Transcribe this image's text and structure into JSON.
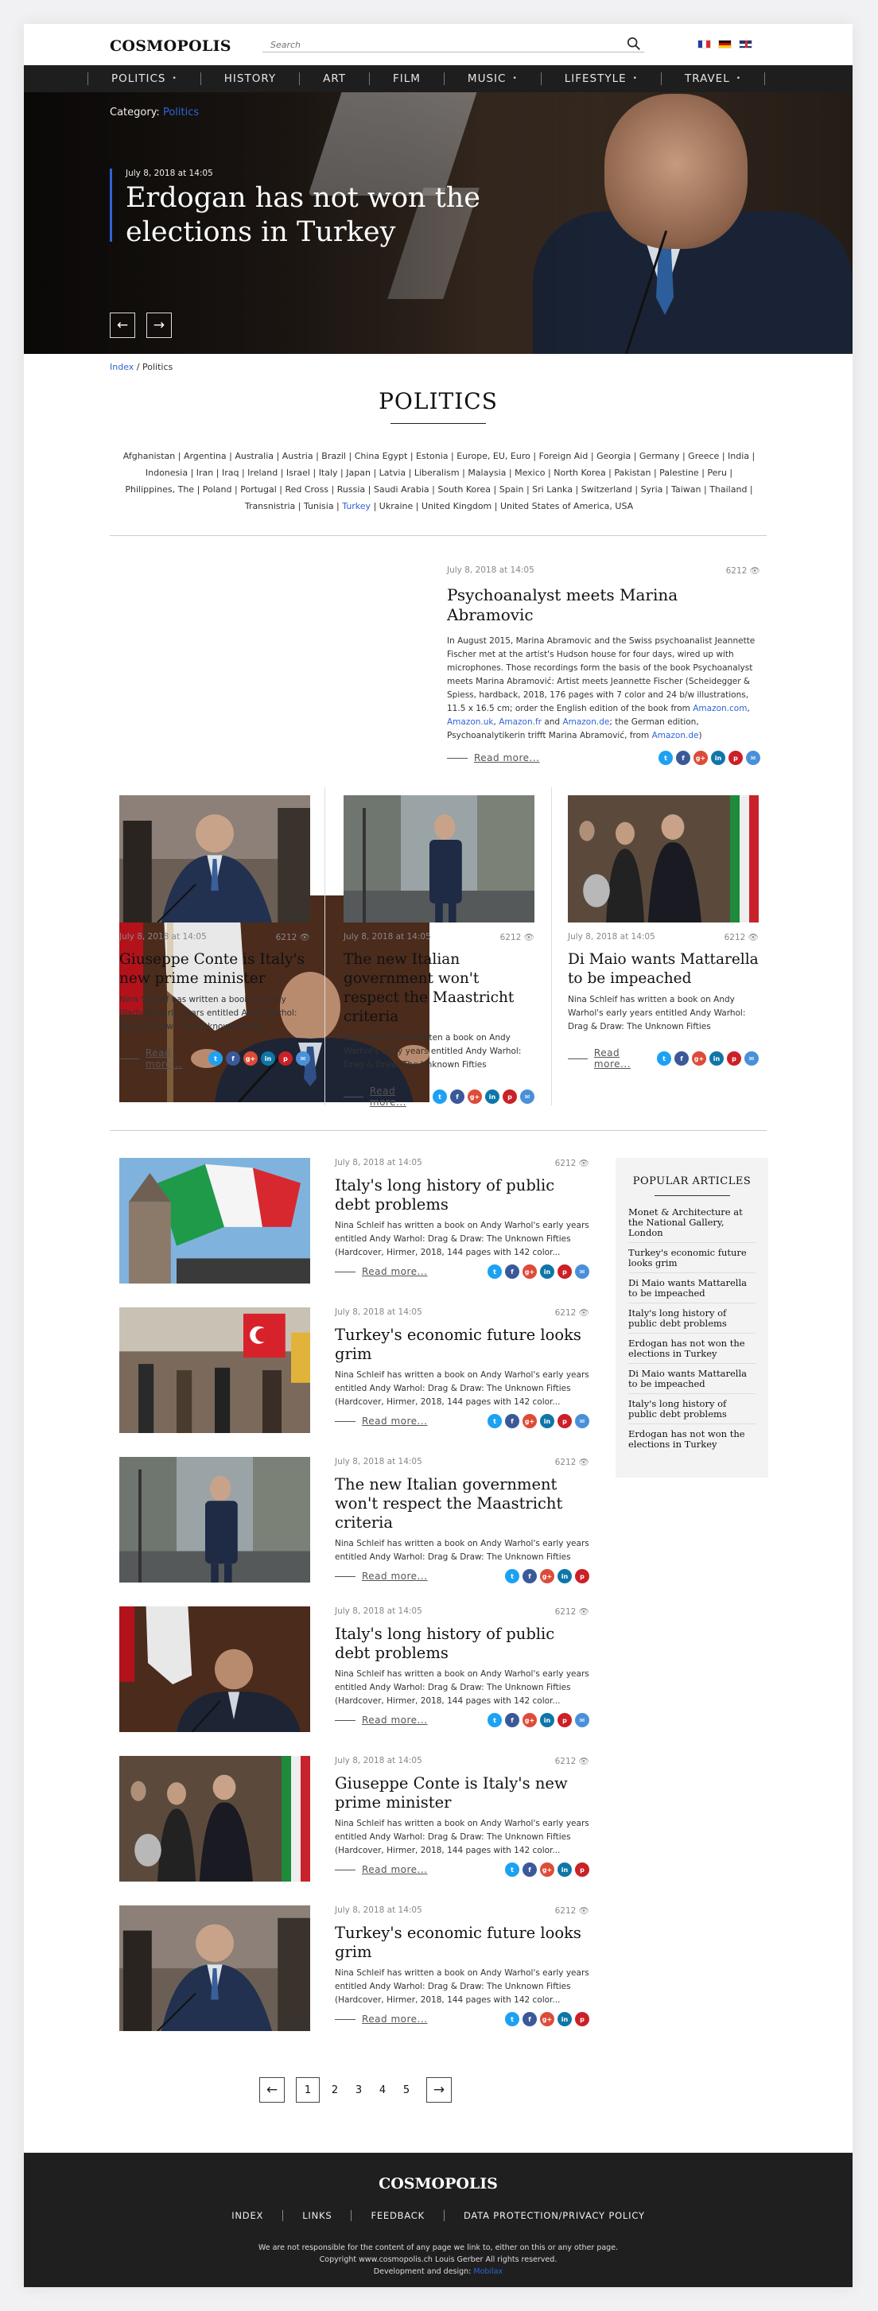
{
  "header": {
    "logo": "COSMOPOLIS",
    "search_placeholder": "Search",
    "flags": [
      "fr-flag-icon",
      "de-flag-icon",
      "gb-flag-icon"
    ]
  },
  "nav": [
    {
      "label": "POLITICS",
      "dropdown": true
    },
    {
      "label": "HISTORY",
      "dropdown": false
    },
    {
      "label": "ART",
      "dropdown": false
    },
    {
      "label": "FILM",
      "dropdown": false
    },
    {
      "label": "MUSIC",
      "dropdown": true
    },
    {
      "label": "LIFESTYLE",
      "dropdown": true
    },
    {
      "label": "TRAVEL",
      "dropdown": true
    }
  ],
  "hero": {
    "category_label": "Category:",
    "category_value": "Politics",
    "date": "July 8, 2018 at 14:05",
    "title": "Erdogan has not won the elections in Turkey",
    "prev_icon": "arrow-left-icon",
    "next_icon": "arrow-right-icon"
  },
  "breadcrumb": {
    "home": "Index",
    "separator": "/",
    "current": "Politics"
  },
  "section_title": "POLITICS",
  "tags": [
    "Afghanistan",
    "Argentina",
    "Australia",
    "Austria",
    "Brazil",
    "China Egypt",
    "Estonia",
    "Europe, EU, Euro",
    "Foreign Aid",
    "Georgia",
    "Germany",
    "Greece",
    "India",
    "Indonesia",
    "Iran",
    "Iraq",
    "Ireland",
    "Israel",
    "Italy",
    "Japan",
    "Latvia",
    "Liberalism",
    "Malaysia",
    "Mexico",
    "North Korea",
    "Pakistan",
    "Palestine",
    "Peru",
    "Philippines, The",
    "Poland",
    "Portugal",
    "Red Cross",
    "Russia",
    "Saudi Arabia",
    "South Korea",
    "Spain",
    "Sri Lanka",
    "Switzerland",
    "Syria",
    "Taiwan",
    "Thailand",
    "Transnistria",
    "Tunisia",
    "Turkey",
    "Ukraine",
    "United Kingdom",
    "United States of America, USA"
  ],
  "active_tag": "Turkey",
  "featured": {
    "date": "July 8, 2018 at 14:05",
    "views": "6212",
    "title": "Psychoanalyst meets Marina Abramovic",
    "body_parts": [
      "In August 2015, Marina Abramovic and the Swiss psychoanalist Jeannette Fischer met at the artist's Hudson house for four days, wired up with microphones. Those recordings form the basis of the book Psychoanalyst meets Marina Abramović: Artist meets Jeannette Fischer (Scheidegger & Spiess, hardback, 2018, 176 pages with 7 color and 24 b/w illustrations, 11.5 x 16.5 cm; order the English edition of the book from ",
      "Amazon.com",
      ", ",
      "Amazon.uk",
      ", ",
      "Amazon.fr",
      " and ",
      "Amazon.de",
      "; the German edition, Psychoanalytikerin trifft Marina Abramović, from ",
      "Amazon.de",
      ")"
    ],
    "more": "Read more..."
  },
  "cards": [
    {
      "date": "July 8, 2018 at 14:05",
      "views": "6212",
      "title": "Giuseppe Conte is Italy's new prime minister",
      "body": "Nina Schleif has written a book on Andy Warhol's early years entitled Andy Warhol: Drag & Draw: The Unknown Fifties (Hardcover, Hirmer, 2018, 144 pages with 142 color",
      "more": "Read more..."
    },
    {
      "date": "July 8, 2018 at 14:05",
      "views": "6212",
      "title": "The new Italian government won't respect the Maastricht criteria",
      "body": "Nina Schleif has written a book on Andy Warhol's early years entitled Andy Warhol: Drag & Draw: The Unknown Fifties (Hardcover,",
      "more": "Read more..."
    },
    {
      "date": "July 8, 2018 at 14:05",
      "views": "6212",
      "title": "Di Maio wants Mattarella to be impeached",
      "body": "Nina Schleif has written a book on Andy Warhol's early years entitled Andy Warhol: Drag & Draw: The Unknown Fifties (Hardcover, Hirmer, 2018, 144 pages with 142 color",
      "more": "Read more..."
    }
  ],
  "articles": [
    {
      "date": "July 8, 2018 at 14:05",
      "views": "6212",
      "title": "Italy's long history of public debt problems",
      "body": "Nina Schleif has written a book on Andy Warhol's early years entitled Andy Warhol: Drag & Draw: The Unknown Fifties (Hardcover, Hirmer, 2018, 144 pages with 142 color...",
      "more": "Read more..."
    },
    {
      "date": "July 8, 2018 at 14:05",
      "views": "6212",
      "title": "Turkey's economic future looks grim",
      "body": "Nina Schleif has written a book on Andy Warhol's early years entitled Andy Warhol: Drag & Draw: The Unknown Fifties (Hardcover, Hirmer, 2018, 144 pages with 142 color...",
      "more": "Read more..."
    },
    {
      "date": "July 8, 2018 at 14:05",
      "views": "6212",
      "title": "The new Italian government won't respect the Maastricht criteria",
      "body": "Nina Schleif has written a book on Andy Warhol's early years entitled Andy Warhol: Drag & Draw: The Unknown Fifties",
      "more": "Read more..."
    },
    {
      "date": "July 8, 2018 at 14:05",
      "views": "6212",
      "title": "Italy's long history of public debt problems",
      "body": "Nina Schleif has written a book on Andy Warhol's early years entitled Andy Warhol: Drag & Draw: The Unknown Fifties (Hardcover, Hirmer, 2018, 144 pages with 142 color...",
      "more": "Read more..."
    },
    {
      "date": "July 8, 2018 at 14:05",
      "views": "6212",
      "title": "Giuseppe Conte is Italy's new prime minister",
      "body": "Nina Schleif has written a book on Andy Warhol's early years entitled Andy Warhol: Drag & Draw: The Unknown Fifties (Hardcover, Hirmer, 2018, 144 pages with 142 color...",
      "more": "Read more..."
    },
    {
      "date": "July 8, 2018 at 14:05",
      "views": "6212",
      "title": "Turkey's economic future looks grim",
      "body": "Nina Schleif has written a book on Andy Warhol's early years entitled Andy Warhol: Drag & Draw: The Unknown Fifties (Hardcover, Hirmer, 2018, 144 pages with 142 color...",
      "more": "Read more..."
    }
  ],
  "popular": {
    "heading": "POPULAR ARTICLES",
    "items": [
      "Monet & Architecture at the National Gallery, London",
      "Turkey's economic future looks grim",
      "Di Maio wants Mattarella to be impeached",
      "Italy's long history of public debt problems",
      "Erdogan has not won the elections in Turkey",
      "Di Maio wants Mattarella to be impeached",
      "Italy's long history of public debt problems",
      "Erdogan has not won the elections in Turkey"
    ]
  },
  "pagination": {
    "pages": [
      "1",
      "2",
      "3",
      "4",
      "5"
    ],
    "current": "1"
  },
  "footer": {
    "logo": "COSMOPOLIS",
    "links": [
      "INDEX",
      "LINKS",
      "FEEDBACK",
      "DATA PROTECTION/PRIVACY POLICY"
    ],
    "disclaimer": "We are not responsible for the content of any page we link to, either on this or any other page.",
    "copyright": "Copyright www.cosmopolis.ch Louis Gerber All rights reserved.",
    "dev_label": "Development and design:",
    "dev_name": "Mobilax"
  },
  "colors": {
    "accent": "#2f63d8",
    "nav_bg": "#1e1e1e",
    "footer_bg": "#1f1f1f",
    "popular_bg": "#f3f3f3"
  }
}
